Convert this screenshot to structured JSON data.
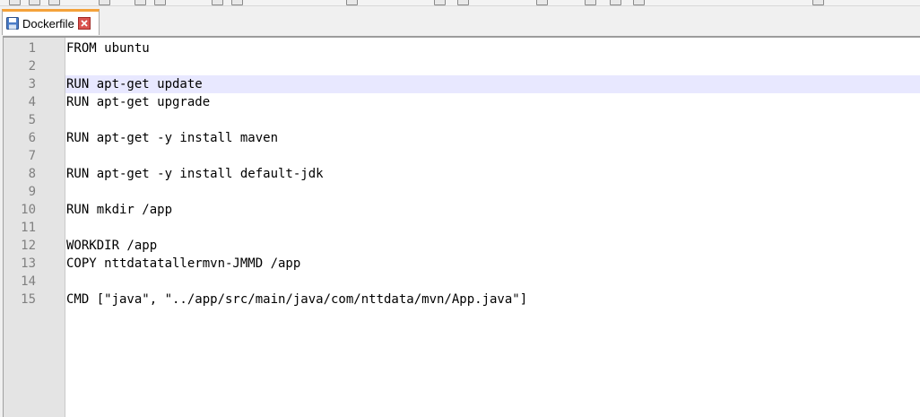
{
  "tab": {
    "filename": "Dockerfile",
    "icons": {
      "file": "save-icon",
      "close": "close-icon"
    }
  },
  "editor": {
    "current_line": 3,
    "lines": [
      {
        "number": "1",
        "text": "FROM ubuntu"
      },
      {
        "number": "2",
        "text": ""
      },
      {
        "number": "3",
        "text": "RUN apt-get update"
      },
      {
        "number": "4",
        "text": "RUN apt-get upgrade"
      },
      {
        "number": "5",
        "text": ""
      },
      {
        "number": "6",
        "text": "RUN apt-get -y install maven"
      },
      {
        "number": "7",
        "text": ""
      },
      {
        "number": "8",
        "text": "RUN apt-get -y install default-jdk"
      },
      {
        "number": "9",
        "text": ""
      },
      {
        "number": "10",
        "text": "RUN mkdir /app"
      },
      {
        "number": "11",
        "text": ""
      },
      {
        "number": "12",
        "text": "WORKDIR /app"
      },
      {
        "number": "13",
        "text": "COPY nttdatatallermvn-JMMD /app"
      },
      {
        "number": "14",
        "text": ""
      },
      {
        "number": "15",
        "text": "CMD [\"java\", \"../app/src/main/java/com/nttdata/mvn/App.java\"]"
      }
    ]
  },
  "colors": {
    "tab_accent": "#f4a23a",
    "current_line_highlight": "#e8e8ff",
    "gutter_background": "#e4e4e4",
    "line_number": "#808080"
  }
}
